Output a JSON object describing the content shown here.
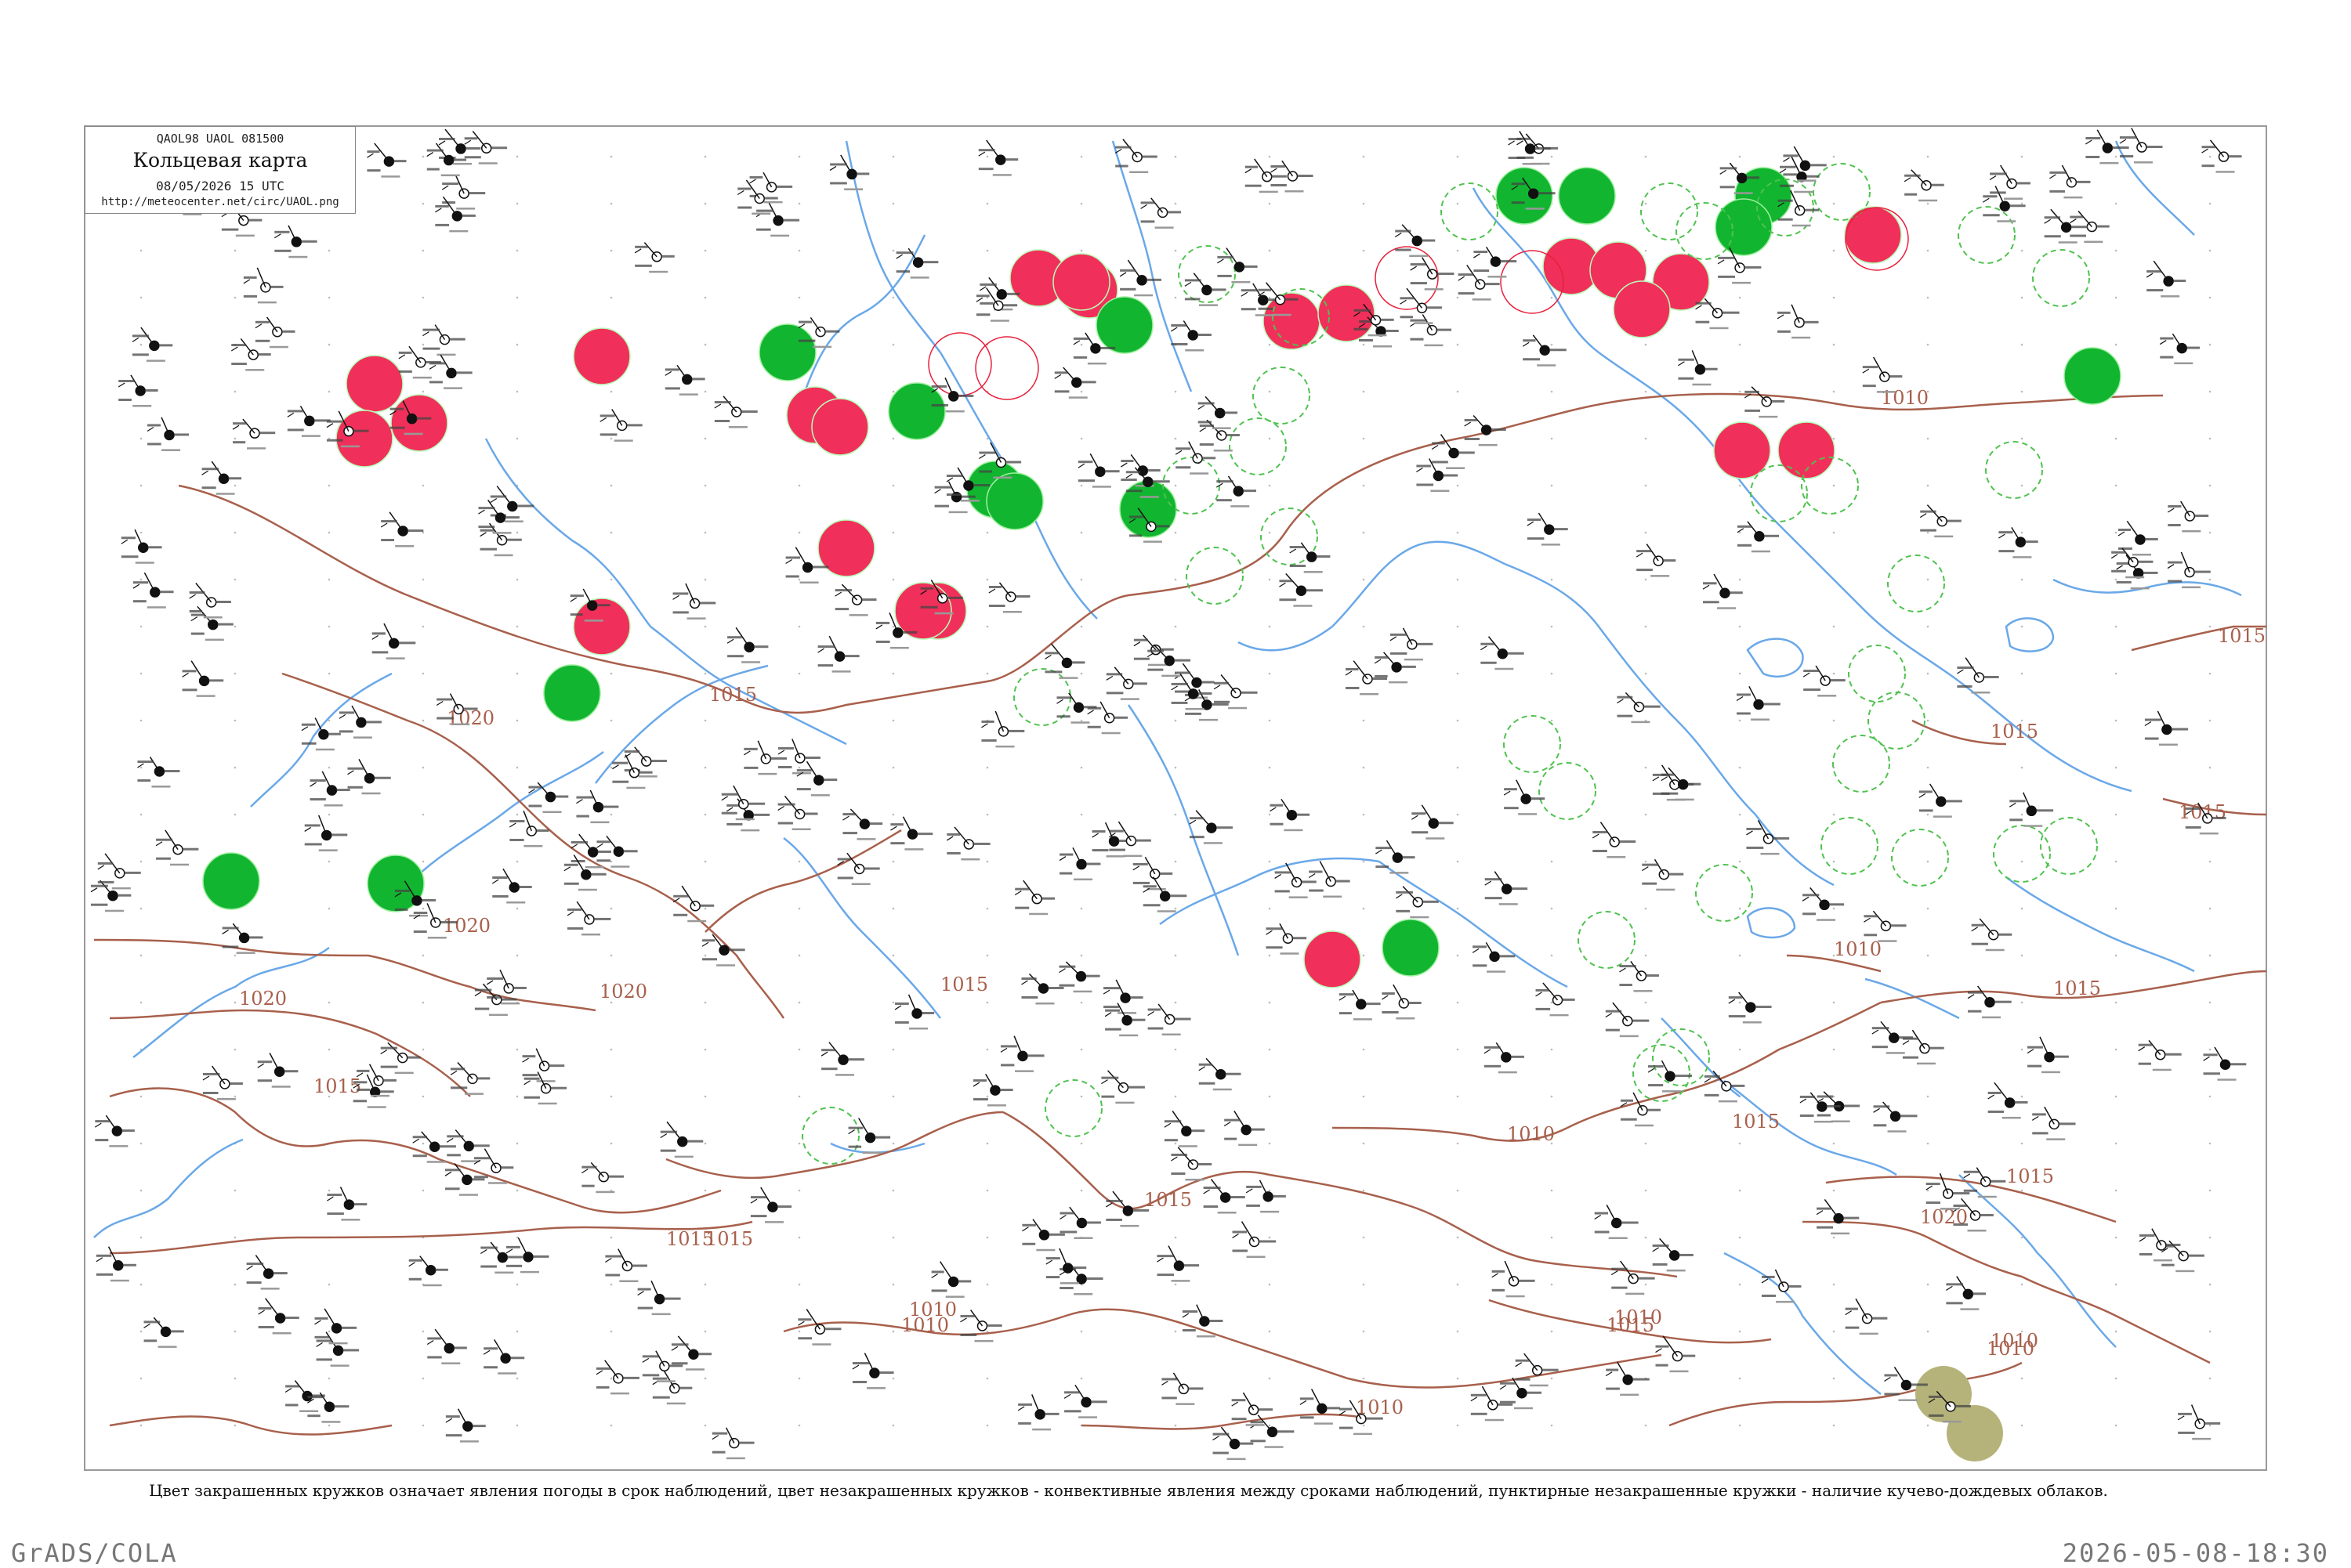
{
  "legend": {
    "code_line": "QAOL98  UAOL  081500",
    "title": "Кольцевая карта",
    "date_line": "08/05/2026 15 UTC",
    "url": "http://meteocenter.net/circ/UAOL.png"
  },
  "caption": "Цвет закрашенных кружков означает явления погоды в срок наблюдений, цвет незакрашенных кружков - конвективные явления между сроками наблюдений, пунктирные незакрашенные кружки - наличие кучево-дождевых облаков.",
  "footer": {
    "left": "GrADS/COLA",
    "right": "2026-05-08-18:30"
  },
  "colors": {
    "rain": "#f0305a",
    "shower_green": "#12b530",
    "dust_olive": "#b5b37a",
    "isobar": "#a8604c",
    "river": "#6aa8e8",
    "cb_dashed": "#4fc24f",
    "conv_ring": "#e8203c",
    "station": "#111111"
  },
  "isobar_labels": [
    {
      "text": "1015"
    },
    {
      "text": "1020"
    },
    {
      "text": "1020"
    },
    {
      "text": "1020"
    },
    {
      "text": "1020"
    },
    {
      "text": "1015"
    },
    {
      "text": "1015"
    },
    {
      "text": "1015"
    },
    {
      "text": "1010"
    },
    {
      "text": "1010"
    },
    {
      "text": "1015"
    },
    {
      "text": "1010"
    },
    {
      "text": "1010"
    },
    {
      "text": "1010"
    },
    {
      "text": "1015"
    },
    {
      "text": "1015"
    },
    {
      "text": "1010"
    },
    {
      "text": "1015"
    },
    {
      "text": "1020"
    },
    {
      "text": "1015"
    },
    {
      "text": "1010"
    },
    {
      "text": "1010"
    },
    {
      "text": "1015"
    },
    {
      "text": "1015"
    },
    {
      "text": "1010"
    },
    {
      "text": "1015"
    },
    {
      "text": "1015"
    }
  ],
  "stations": [
    {
      "obs": "rain"
    },
    {
      "obs": "rain"
    },
    {
      "obs": "rain"
    },
    {
      "obs": "rain"
    },
    {
      "obs": "rain"
    },
    {
      "obs": "rain"
    },
    {
      "obs": "rain"
    },
    {
      "obs": "rain"
    },
    {
      "obs": "rain"
    },
    {
      "obs": "rain"
    },
    {
      "obs": "rain"
    },
    {
      "obs": "rain"
    },
    {
      "obs": "rain"
    },
    {
      "obs": "rain"
    },
    {
      "obs": "rain"
    },
    {
      "obs": "rain"
    },
    {
      "obs": "rain"
    },
    {
      "obs": "rain"
    },
    {
      "obs": "rain"
    },
    {
      "obs": "rain"
    },
    {
      "obs": "rain"
    },
    {
      "obs": "rain"
    },
    {
      "obs": "rain"
    },
    {
      "obs": "shower"
    },
    {
      "obs": "shower"
    },
    {
      "obs": "shower"
    },
    {
      "obs": "shower"
    },
    {
      "obs": "shower"
    },
    {
      "obs": "shower"
    },
    {
      "obs": "shower"
    },
    {
      "obs": "shower"
    },
    {
      "obs": "shower"
    },
    {
      "obs": "shower"
    },
    {
      "obs": "shower"
    },
    {
      "obs": "shower"
    },
    {
      "obs": "shower"
    },
    {
      "obs": "shower"
    },
    {
      "obs": "shower"
    },
    {
      "obs": "dust"
    },
    {
      "obs": "dust"
    },
    {
      "obs": "cb"
    },
    {
      "obs": "cb"
    },
    {
      "obs": "cb"
    },
    {
      "obs": "cb"
    },
    {
      "obs": "cb"
    },
    {
      "obs": "cb"
    },
    {
      "obs": "cb"
    },
    {
      "obs": "cb"
    },
    {
      "obs": "cb"
    },
    {
      "obs": "cb"
    },
    {
      "obs": "cb"
    },
    {
      "obs": "cb"
    },
    {
      "obs": "cb"
    },
    {
      "obs": "cb"
    },
    {
      "obs": "cb"
    },
    {
      "obs": "cb"
    },
    {
      "obs": "cb"
    },
    {
      "obs": "cb"
    },
    {
      "obs": "cb"
    },
    {
      "obs": "cb"
    },
    {
      "obs": "cb"
    },
    {
      "obs": "cb"
    },
    {
      "obs": "cb"
    },
    {
      "obs": "cb"
    },
    {
      "obs": "cb"
    },
    {
      "obs": "cb"
    },
    {
      "obs": "cb"
    },
    {
      "obs": "cb"
    },
    {
      "obs": "cb"
    },
    {
      "obs": "cb"
    },
    {
      "obs": "cb"
    },
    {
      "obs": "cb"
    },
    {
      "obs": "cb"
    },
    {
      "obs": "cb"
    }
  ]
}
